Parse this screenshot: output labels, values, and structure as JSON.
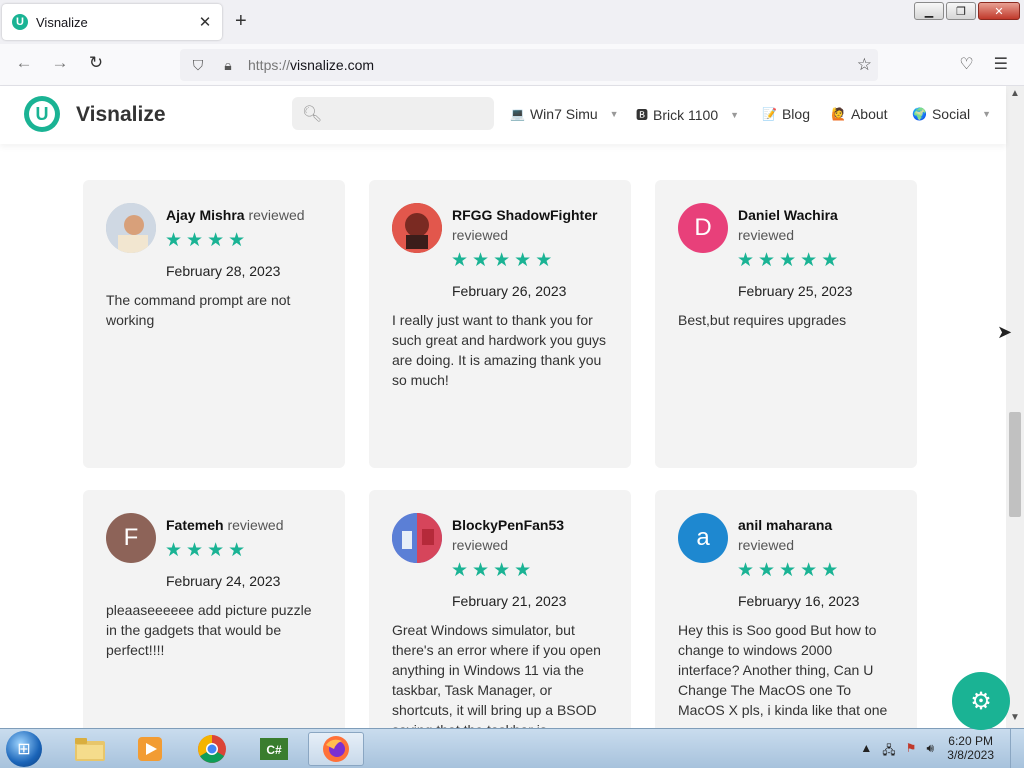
{
  "browser": {
    "tab_title": "Visnalize",
    "tab_favicon_letter": "U",
    "close_glyph": "✕",
    "new_tab_glyph": "+",
    "url_protocol": "https://",
    "url_host": "visnalize.com"
  },
  "site": {
    "logo_letter": "U",
    "brand": "Visnalize",
    "search_placeholder": "",
    "menu": [
      {
        "label": "Win7 Simu",
        "icon": "💻",
        "has_caret": true
      },
      {
        "label": "Brick 1100",
        "icon": "🅱",
        "has_caret": true
      },
      {
        "label": "Blog",
        "icon": "📝",
        "has_caret": false
      },
      {
        "label": "About",
        "icon": "🙋",
        "has_caret": false
      },
      {
        "label": "Social",
        "icon": "🌍",
        "has_caret": true
      }
    ],
    "accent_color": "#1ab394"
  },
  "reviews": [
    {
      "name": "Ajay Mishra",
      "suffix": "reviewed",
      "stars": 4,
      "date": "February 28, 2023",
      "body": "The command prompt are not working",
      "avatar_letter": "",
      "avatar_color": "#b9c4d0"
    },
    {
      "name": "RFGG ShadowFighter",
      "suffix": "reviewed",
      "stars": 5,
      "date": "February 26, 2023",
      "body": "I really just want to thank you for such great and hardwork you guys are doing. It is amazing thank you so much!",
      "avatar_letter": "",
      "avatar_color": "#c0392b"
    },
    {
      "name": "Daniel Wachira",
      "suffix": "reviewed",
      "stars": 5,
      "date": "February 25, 2023",
      "body": "Best,but requires upgrades",
      "avatar_letter": "D",
      "avatar_color": "#e8407a"
    },
    {
      "name": "Fatemeh",
      "suffix": "reviewed",
      "stars": 4,
      "date": "February 24, 2023",
      "body": "pleaaseeeeee add picture puzzle in the gadgets that would be perfect!!!!",
      "avatar_letter": "F",
      "avatar_color": "#8d6358"
    },
    {
      "name": "BlockyPenFan53",
      "suffix": "reviewed",
      "stars": 4,
      "date": "February 21, 2023",
      "body": "Great Windows simulator, but there's an error where if you open anything in Windows 11 via the taskbar, Task Manager, or shortcuts, it will bring up a BSOD saying that the taskbar is",
      "avatar_letter": "",
      "avatar_color": "#6a5acd"
    },
    {
      "name": "anil maharana",
      "suffix": "reviewed",
      "stars": 5,
      "date": "Februaryy 16, 2023",
      "body": "Hey this is Soo good But how to change to windows 2000 interface? Another thing, Can U Change The MacOS one To MacOS X pls, i kinda like that one",
      "avatar_letter": "a",
      "avatar_color": "#1e88d0"
    }
  ],
  "taskbar": {
    "time": "6:20 PM",
    "date": "3/8/2023"
  }
}
